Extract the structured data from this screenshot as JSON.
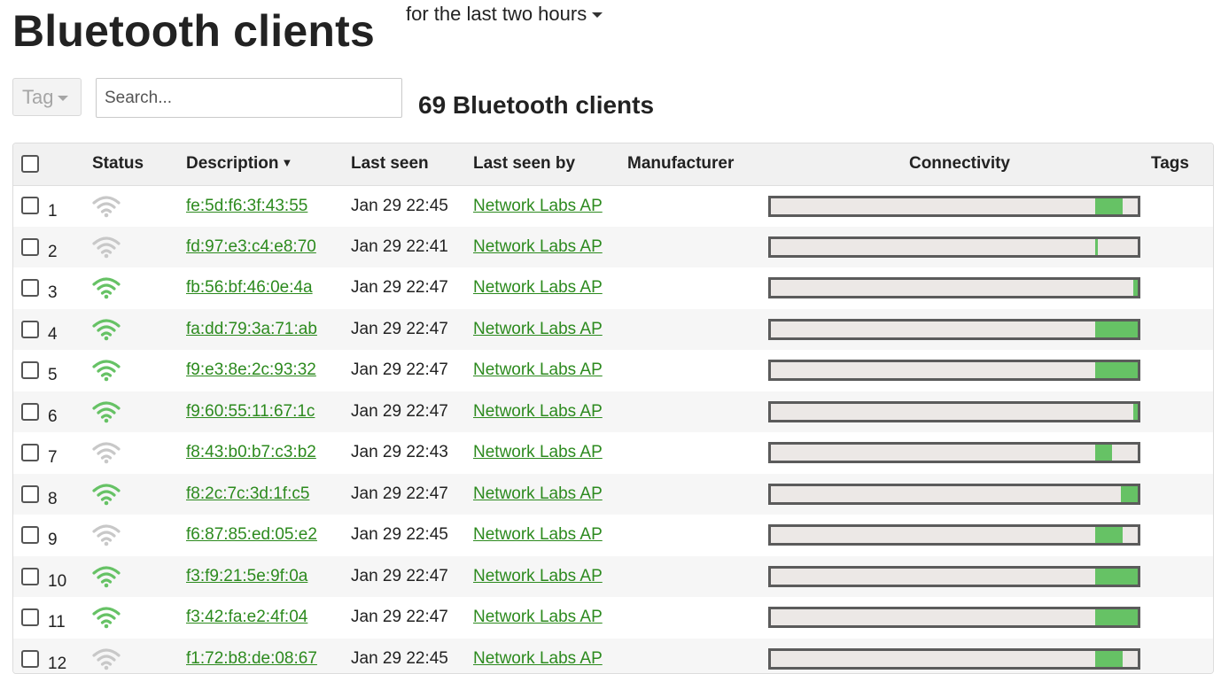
{
  "page": {
    "title": "Bluetooth clients",
    "timespan_label": "for the last two hours",
    "tag_label": "Tag",
    "search_placeholder": "Search...",
    "count_label": "69 Bluetooth clients"
  },
  "colors": {
    "accent_green": "#66c265",
    "link_green": "#2c8a1e",
    "offline_gray": "#c8c8c8"
  },
  "table": {
    "columns": {
      "status": "Status",
      "description": "Description",
      "last_seen": "Last seen",
      "last_seen_by": "Last seen by",
      "manufacturer": "Manufacturer",
      "connectivity": "Connectivity",
      "tags": "Tags"
    },
    "rows": [
      {
        "num": "1",
        "status": "offline",
        "description": "fe:5d:f6:3f:43:55",
        "last_seen": "Jan 29 22:45",
        "last_seen_by": "Network Labs AP",
        "manufacturer": "",
        "conn_start": 0.885,
        "conn_end": 0.96
      },
      {
        "num": "2",
        "status": "offline",
        "description": "fd:97:e3:c4:e8:70",
        "last_seen": "Jan 29 22:41",
        "last_seen_by": "Network Labs AP",
        "manufacturer": "",
        "conn_start": 0.885,
        "conn_end": 0.891
      },
      {
        "num": "3",
        "status": "online",
        "description": "fb:56:bf:46:0e:4a",
        "last_seen": "Jan 29 22:47",
        "last_seen_by": "Network Labs AP",
        "manufacturer": "",
        "conn_start": 0.988,
        "conn_end": 1.0
      },
      {
        "num": "4",
        "status": "online",
        "description": "fa:dd:79:3a:71:ab",
        "last_seen": "Jan 29 22:47",
        "last_seen_by": "Network Labs AP",
        "manufacturer": "",
        "conn_start": 0.885,
        "conn_end": 1.0
      },
      {
        "num": "5",
        "status": "online",
        "description": "f9:e3:8e:2c:93:32",
        "last_seen": "Jan 29 22:47",
        "last_seen_by": "Network Labs AP",
        "manufacturer": "",
        "conn_start": 0.885,
        "conn_end": 1.0
      },
      {
        "num": "6",
        "status": "online",
        "description": "f9:60:55:11:67:1c",
        "last_seen": "Jan 29 22:47",
        "last_seen_by": "Network Labs AP",
        "manufacturer": "",
        "conn_start": 0.988,
        "conn_end": 1.0
      },
      {
        "num": "7",
        "status": "offline",
        "description": "f8:43:b0:b7:c3:b2",
        "last_seen": "Jan 29 22:43",
        "last_seen_by": "Network Labs AP",
        "manufacturer": "",
        "conn_start": 0.885,
        "conn_end": 0.93
      },
      {
        "num": "8",
        "status": "online",
        "description": "f8:2c:7c:3d:1f:c5",
        "last_seen": "Jan 29 22:47",
        "last_seen_by": "Network Labs AP",
        "manufacturer": "",
        "conn_start": 0.955,
        "conn_end": 1.0
      },
      {
        "num": "9",
        "status": "offline",
        "description": "f6:87:85:ed:05:e2",
        "last_seen": "Jan 29 22:45",
        "last_seen_by": "Network Labs AP",
        "manufacturer": "",
        "conn_start": 0.885,
        "conn_end": 0.96
      },
      {
        "num": "10",
        "status": "online",
        "description": "f3:f9:21:5e:9f:0a",
        "last_seen": "Jan 29 22:47",
        "last_seen_by": "Network Labs AP",
        "manufacturer": "",
        "conn_start": 0.885,
        "conn_end": 1.0
      },
      {
        "num": "11",
        "status": "online",
        "description": "f3:42:fa:e2:4f:04",
        "last_seen": "Jan 29 22:47",
        "last_seen_by": "Network Labs AP",
        "manufacturer": "",
        "conn_start": 0.885,
        "conn_end": 1.0
      },
      {
        "num": "12",
        "status": "offline",
        "description": "f1:72:b8:de:08:67",
        "last_seen": "Jan 29 22:45",
        "last_seen_by": "Network Labs AP",
        "manufacturer": "",
        "conn_start": 0.885,
        "conn_end": 0.96
      }
    ]
  }
}
